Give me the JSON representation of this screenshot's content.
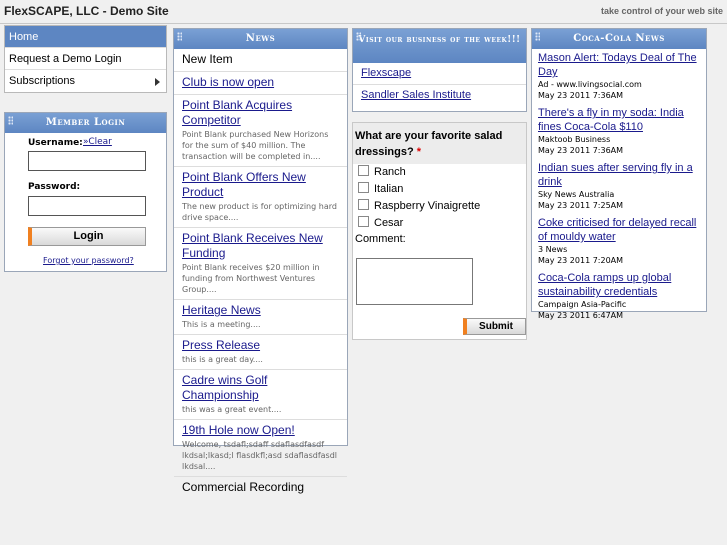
{
  "header": {
    "site_title": "FlexSCAPE, LLC - Demo Site",
    "tagline": "take control of your web site"
  },
  "nav": {
    "items": [
      {
        "label": "Home"
      },
      {
        "label": "Request a Demo Login"
      },
      {
        "label": "Subscriptions"
      }
    ]
  },
  "login": {
    "title": "Member Login",
    "username_label": "Username:",
    "clear_label": "»Clear",
    "password_label": "Password:",
    "button_label": "Login",
    "forgot_label": "Forgot your password?"
  },
  "news": {
    "title": "News",
    "items": [
      {
        "title": "New Item",
        "desc": ""
      },
      {
        "title": "Club is now open",
        "desc": ""
      },
      {
        "title": "Point Blank Acquires Competitor",
        "desc": "Point Blank purchased New Horizons for the sum of $40 million. The transaction will be completed in...."
      },
      {
        "title": "Point Blank Offers New Product",
        "desc": "The new product is for optimizing hard drive space...."
      },
      {
        "title": "Point Blank Receives New Funding",
        "desc": "Point Blank receives $20 million in funding from Northwest Ventures Group...."
      },
      {
        "title": "Heritage News",
        "desc": "This is a meeting...."
      },
      {
        "title": "Press Release",
        "desc": "this is a great day...."
      },
      {
        "title": "Cadre wins Golf Championship",
        "desc": "this was a great event...."
      },
      {
        "title": "19th Hole now Open!",
        "desc": "Welcome, tsdafl;sdaff sdaflasdfasdf lkdsal;lkasd;l flasdkfl;asd sdaflasdfasdl lkdsal...."
      },
      {
        "title": "Commercial Recording",
        "desc": ""
      }
    ]
  },
  "visit": {
    "title": "Visit our business of the week!!!",
    "items": [
      {
        "label": "Flexscape"
      },
      {
        "label": "Sandler Sales Institute"
      }
    ]
  },
  "poll": {
    "question": "What are your favorite salad dressings?",
    "required_mark": "*",
    "options": [
      {
        "label": "Ranch"
      },
      {
        "label": "Italian"
      },
      {
        "label": "Raspberry Vinaigrette"
      },
      {
        "label": "Cesar"
      }
    ],
    "comment_label": "Comment:",
    "submit_label": "Submit"
  },
  "coke": {
    "title": "Coca-Cola News",
    "items": [
      {
        "title": "Mason Alert: Todays Deal of The Day",
        "source": "Ad - www.livingsocial.com",
        "date": "May 23 2011 7:36AM"
      },
      {
        "title": "There's a fly in my soda: India fines Coca-Cola $110",
        "source": "Maktoob Business",
        "date": "May 23 2011 7:36AM"
      },
      {
        "title": "Indian sues after serving fly in a drink",
        "source": "Sky News Australia",
        "date": "May 23 2011 7:25AM"
      },
      {
        "title": "Coke criticised for delayed recall of mouldy water",
        "source": "3 News",
        "date": "May 23 2011 7:20AM"
      },
      {
        "title": "Coca-Cola ramps up global sustainability credentials",
        "source": "Campaign Asia-Pacific",
        "date": "May 23 2011 6:47AM"
      }
    ]
  },
  "colors": {
    "panel_header": "#5d86c2",
    "nav_active": "#5d86c2",
    "button_accent": "#f08020",
    "link": "#1a1a8c",
    "background": "#f0f0f0"
  }
}
